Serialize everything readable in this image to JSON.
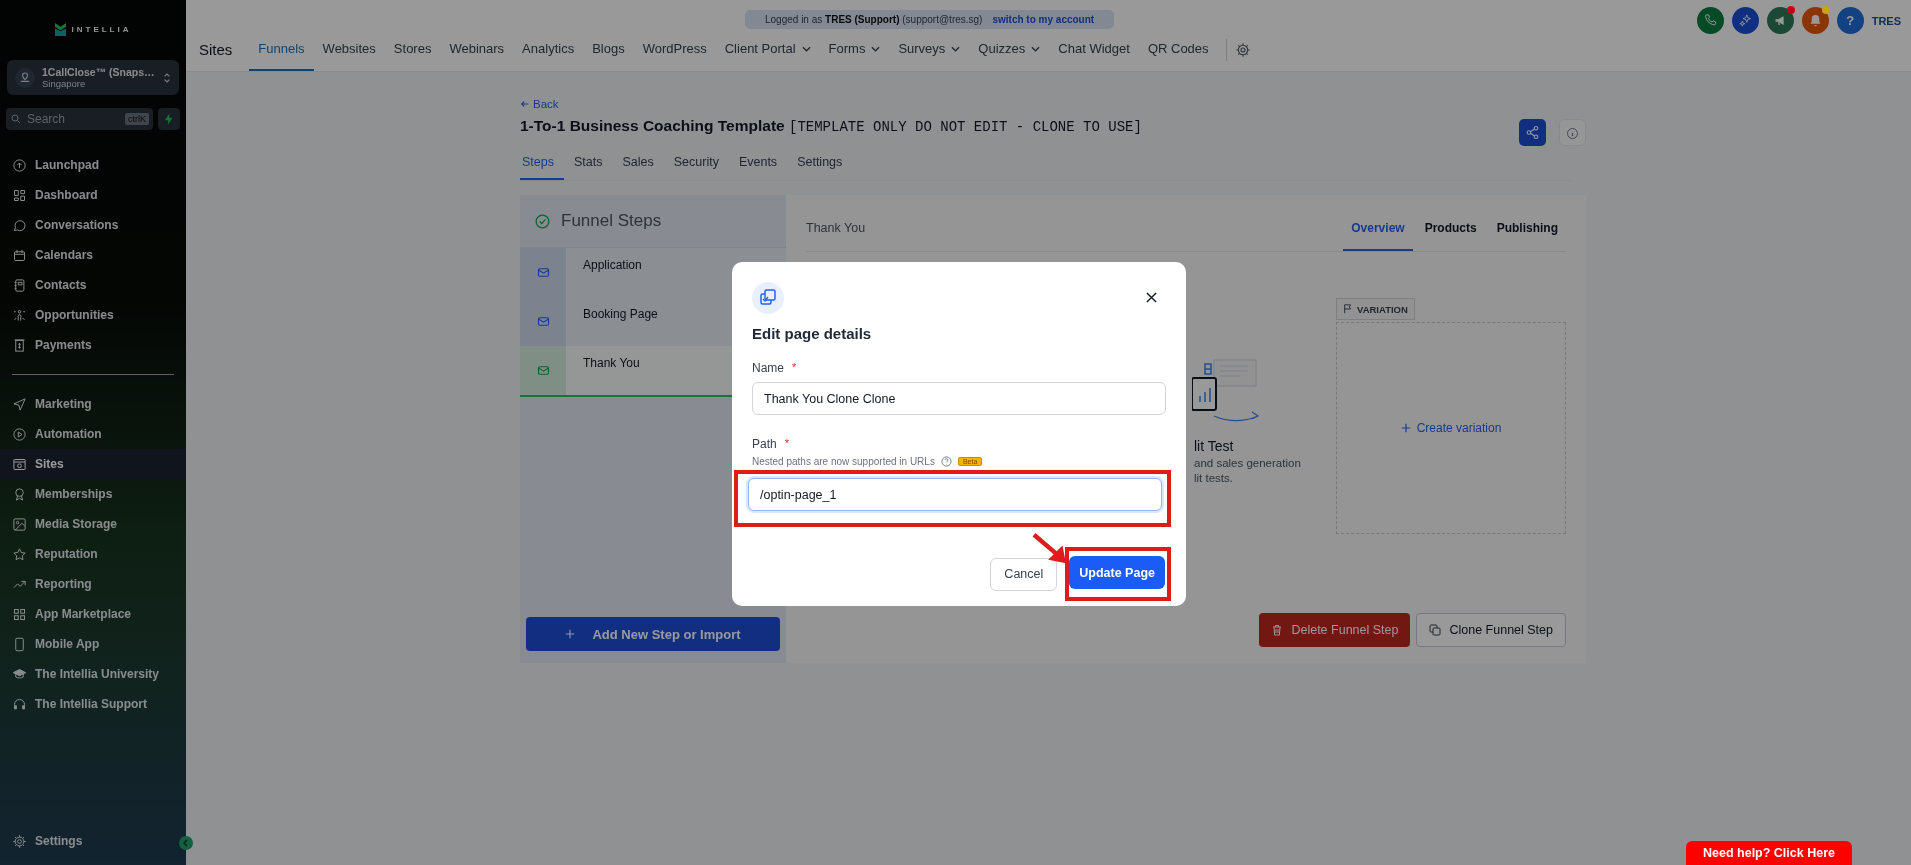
{
  "sidebar": {
    "logo": "INTELLIA",
    "account": {
      "name": "1CallClose™ (Snaps…",
      "location": "Singapore"
    },
    "search": {
      "placeholder": "Search",
      "shortcut": "ctrlK"
    },
    "nav_sections": [
      {
        "items": [
          {
            "label": "Launchpad",
            "selected": false
          },
          {
            "label": "Dashboard",
            "selected": false
          },
          {
            "label": "Conversations",
            "selected": false
          },
          {
            "label": "Calendars",
            "selected": false
          },
          {
            "label": "Contacts",
            "selected": false
          },
          {
            "label": "Opportunities",
            "selected": false
          },
          {
            "label": "Payments",
            "selected": false
          }
        ]
      },
      {
        "items": [
          {
            "label": "Marketing",
            "selected": false
          },
          {
            "label": "Automation",
            "selected": false
          },
          {
            "label": "Sites",
            "selected": true
          },
          {
            "label": "Memberships",
            "selected": false
          },
          {
            "label": "Media Storage",
            "selected": false
          },
          {
            "label": "Reputation",
            "selected": false
          },
          {
            "label": "Reporting",
            "selected": false
          },
          {
            "label": "App Marketplace",
            "selected": false
          },
          {
            "label": "Mobile App",
            "selected": false
          },
          {
            "label": "The Intellia University",
            "selected": false
          },
          {
            "label": "The Intellia Support",
            "selected": false
          }
        ]
      }
    ],
    "settings": "Settings"
  },
  "topbar": {
    "impersonation": {
      "prefix": "Logged in as",
      "user": "TRES (Support)",
      "email": "(support@tres.sg)",
      "link": "switch to my account"
    },
    "section": "Sites",
    "tabs": [
      {
        "label": "Funnels",
        "selected": true,
        "dropdown": false
      },
      {
        "label": "Websites",
        "selected": false,
        "dropdown": false
      },
      {
        "label": "Stores",
        "selected": false,
        "dropdown": false
      },
      {
        "label": "Webinars",
        "selected": false,
        "dropdown": false
      },
      {
        "label": "Analytics",
        "selected": false,
        "dropdown": false
      },
      {
        "label": "Blogs",
        "selected": false,
        "dropdown": false
      },
      {
        "label": "WordPress",
        "selected": false,
        "dropdown": false
      },
      {
        "label": "Client Portal",
        "selected": false,
        "dropdown": true
      },
      {
        "label": "Forms",
        "selected": false,
        "dropdown": true
      },
      {
        "label": "Surveys",
        "selected": false,
        "dropdown": true
      },
      {
        "label": "Quizzes",
        "selected": false,
        "dropdown": true
      },
      {
        "label": "Chat Widget",
        "selected": false,
        "dropdown": false
      },
      {
        "label": "QR Codes",
        "selected": false,
        "dropdown": false
      }
    ],
    "header_icons": [
      {
        "kind": "phone"
      },
      {
        "kind": "sparkle"
      },
      {
        "kind": "megaphone",
        "color": "#c4001a"
      },
      {
        "kind": "bell",
        "color": "#c9a21a"
      },
      {
        "kind": "help",
        "label": "?"
      }
    ],
    "user": "TRES"
  },
  "page": {
    "back": "Back",
    "title": "1-To-1 Business Coaching Template",
    "title_tag": "[TEMPLATE ONLY DO NOT EDIT - CLONE TO USE]",
    "tabs": [
      {
        "label": "Steps",
        "selected": true
      },
      {
        "label": "Stats",
        "selected": false
      },
      {
        "label": "Sales",
        "selected": false
      },
      {
        "label": "Security",
        "selected": false
      },
      {
        "label": "Events",
        "selected": false
      },
      {
        "label": "Settings",
        "selected": false
      }
    ],
    "funnel_steps": {
      "title": "Funnel Steps",
      "steps": [
        {
          "name": "Application",
          "selected": false
        },
        {
          "name": "Booking Page",
          "selected": false
        },
        {
          "name": "Thank You",
          "selected": true
        }
      ],
      "add_button": "Add New Step or Import"
    },
    "step_detail": {
      "name": "Thank You",
      "tabs": [
        {
          "label": "Overview",
          "selected": true
        },
        {
          "label": "Products",
          "selected": false
        },
        {
          "label": "Publishing",
          "selected": false
        }
      ],
      "split_test": {
        "title": "lit Test",
        "lines": [
          "and sales generation",
          "lit tests."
        ]
      },
      "variation_tag": "VARIATION",
      "create_variation": "Create variation",
      "delete_button": "Delete Funnel Step",
      "clone_button": "Clone Funnel Step"
    }
  },
  "modal": {
    "title": "Edit page details",
    "fields": [
      {
        "label": "Name",
        "required_mark": "*",
        "value": "Thank You Clone Clone"
      },
      {
        "label": "Path",
        "required_mark": "*",
        "hint": "Nested paths are now supported in URLs",
        "badge": "Beta",
        "value": "/optin-page_1"
      }
    ],
    "cancel": "Cancel",
    "submit": "Update Page"
  },
  "help_button": "Need help? Click Here"
}
